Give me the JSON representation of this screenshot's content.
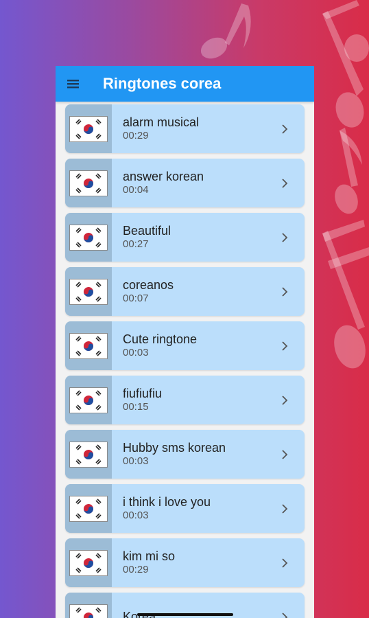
{
  "app": {
    "title": "Ringtones corea",
    "menu_icon": "hamburger-menu-icon"
  },
  "colors": {
    "app_bar": "#2196f3",
    "card": "#bbdefb",
    "bg_left": "#7457cf",
    "bg_right": "#d92c48"
  },
  "ringtones": [
    {
      "name": "alarm musical",
      "duration": "00:29"
    },
    {
      "name": "answer korean",
      "duration": "00:04"
    },
    {
      "name": "Beautiful",
      "duration": "00:27"
    },
    {
      "name": "coreanos",
      "duration": "00:07"
    },
    {
      "name": "Cute ringtone",
      "duration": "00:03"
    },
    {
      "name": "fiufiufiu",
      "duration": "00:15"
    },
    {
      "name": "Hubby sms korean",
      "duration": "00:03"
    },
    {
      "name": "i think i love you",
      "duration": "00:03"
    },
    {
      "name": "kim mi so",
      "duration": "00:29"
    },
    {
      "name": "Korea",
      "duration": ""
    }
  ],
  "item_icons": {
    "thumbnail": "korean-flag-icon",
    "action": "chevron-right-icon"
  }
}
